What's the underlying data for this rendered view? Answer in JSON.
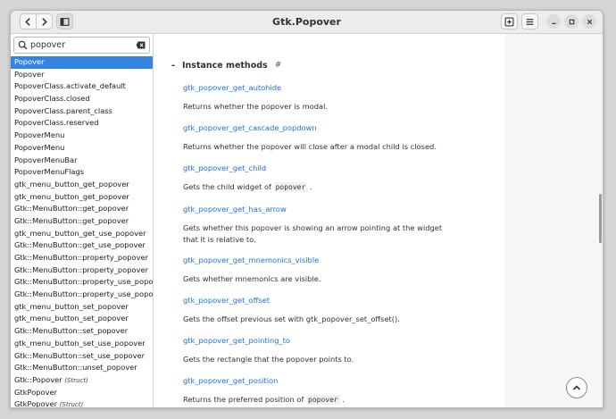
{
  "window": {
    "title": "Gtk.Popover"
  },
  "search": {
    "value": "popover",
    "placeholder": ""
  },
  "results": [
    {
      "label": "Popover",
      "selected": true
    },
    {
      "label": "Popover"
    },
    {
      "label": "PopoverClass.activate_default"
    },
    {
      "label": "PopoverClass.closed"
    },
    {
      "label": "PopoverClass.parent_class"
    },
    {
      "label": "PopoverClass.reserved"
    },
    {
      "label": "PopoverMenu"
    },
    {
      "label": "PopoverMenu"
    },
    {
      "label": "PopoverMenuBar"
    },
    {
      "label": "PopoverMenuFlags"
    },
    {
      "label": "gtk_menu_button_get_popover"
    },
    {
      "label": "gtk_menu_button_get_popover"
    },
    {
      "label": "Gtk::MenuButton::get_popover"
    },
    {
      "label": "Gtk::MenuButton::get_popover"
    },
    {
      "label": "gtk_menu_button_get_use_popover"
    },
    {
      "label": "Gtk::MenuButton::get_use_popover"
    },
    {
      "label": "Gtk::MenuButton::property_popover"
    },
    {
      "label": "Gtk::MenuButton::property_popover"
    },
    {
      "label": "Gtk::MenuButton::property_use_popover"
    },
    {
      "label": "Gtk::MenuButton::property_use_popover"
    },
    {
      "label": "gtk_menu_button_set_popover"
    },
    {
      "label": "gtk_menu_button_set_popover"
    },
    {
      "label": "Gtk::MenuButton::set_popover"
    },
    {
      "label": "gtk_menu_button_set_use_popover"
    },
    {
      "label": "Gtk::MenuButton::set_use_popover"
    },
    {
      "label": "Gtk::MenuButton::unset_popover"
    },
    {
      "label": "Gtk::Popover",
      "tag": "(Struct)"
    },
    {
      "label": "GtkPopover"
    },
    {
      "label": "GtkPopover",
      "tag": "(Struct)"
    }
  ],
  "content": {
    "section_title": "Instance methods",
    "section_toggle": "-",
    "section_anchor": "#",
    "methods": [
      {
        "name": "gtk_popover_get_autohide",
        "desc": "Returns whether the popover is modal."
      },
      {
        "name": "gtk_popover_get_cascade_popdown",
        "desc": "Returns whether the popover will close after a modal child is closed."
      },
      {
        "name": "gtk_popover_get_child",
        "desc_pre": "Gets the child widget of ",
        "desc_code": "popover",
        "desc_post": " ."
      },
      {
        "name": "gtk_popover_get_has_arrow",
        "desc": "Gets whether this popover is showing an arrow pointing at the widget that it is relative to."
      },
      {
        "name": "gtk_popover_get_mnemonics_visible",
        "desc": "Gets whether mnemonics are visible."
      },
      {
        "name": "gtk_popover_get_offset",
        "desc": "Gets the offset previous set with gtk_popover_set_offset()."
      },
      {
        "name": "gtk_popover_get_pointing_to",
        "desc": "Gets the rectangle that the popover points to."
      },
      {
        "name": "gtk_popover_get_position",
        "desc_pre": "Returns the preferred position of ",
        "desc_code": "popover",
        "desc_post": " ."
      }
    ]
  },
  "icons": {
    "back": "go-back-icon",
    "forward": "go-forward-icon",
    "sidebar": "sidebar-toggle-icon",
    "newtab": "new-tab-icon",
    "menu": "hamburger-menu-icon",
    "minimize": "minimize-icon",
    "maximize": "maximize-icon",
    "close": "close-icon",
    "search": "search-icon",
    "clear": "clear-icon",
    "top": "scroll-to-top-icon"
  },
  "colors": {
    "accent": "#3584e4",
    "link": "#1c71d8"
  }
}
